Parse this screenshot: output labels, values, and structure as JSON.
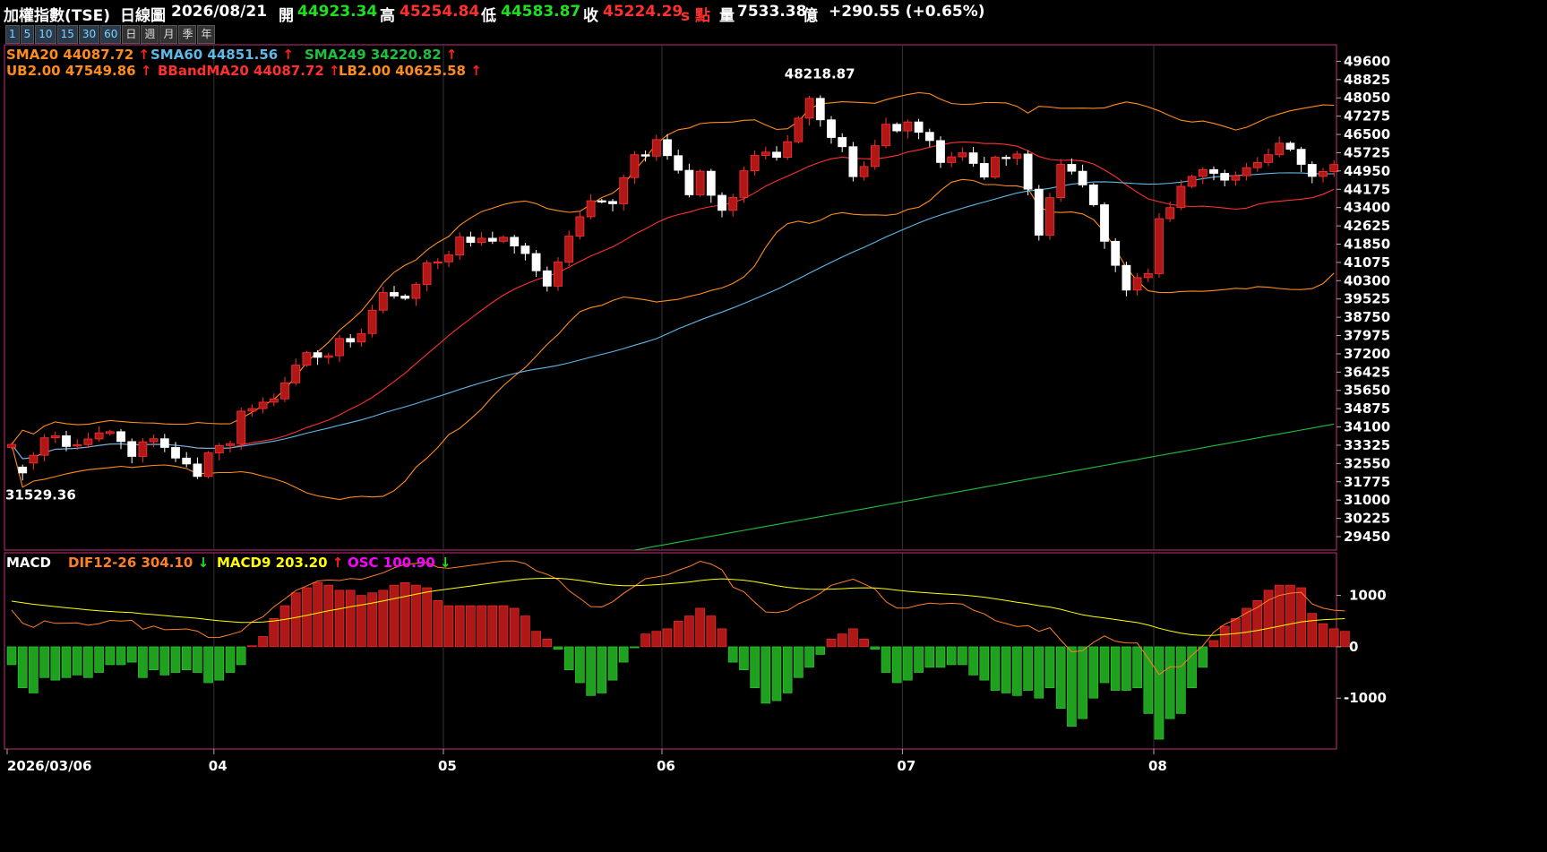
{
  "header": {
    "title": "加權指數(TSE)",
    "interval": "日線圖",
    "date": "2026/08/21",
    "open_label": "開",
    "open": "44923.34",
    "high_label": "高",
    "high": "45254.84",
    "low_label": "低",
    "low": "44583.87",
    "close_label": "收",
    "close": "45224.29",
    "unit_label": "s 點",
    "volume_label": "量",
    "volume": "7533.38",
    "volume_unit": "億",
    "change": "+290.55 (+0.65%)"
  },
  "periods": [
    "1",
    "5",
    "10",
    "15",
    "30",
    "60",
    "日",
    "週",
    "月",
    "季",
    "年"
  ],
  "legend_main": [
    {
      "text": "SMA20 44087.72",
      "color": "#ff8c1a"
    },
    {
      "text": "SMA60 44851.56",
      "color": "#5fb8e8"
    },
    {
      "text": "SMA249 34220.82",
      "color": "#1fbf3f"
    },
    {
      "text": "UB2.00 47549.86",
      "color": "#ff8c1a"
    },
    {
      "text": "BBandMA20 44087.72",
      "color": "#ff3030"
    },
    {
      "text": "LB2.00 40625.58",
      "color": "#ff8c1a"
    }
  ],
  "legend_macd": [
    {
      "text": "MACD",
      "color": "#ffffff",
      "arrow": ""
    },
    {
      "text": "DIF12-26 304.10",
      "color": "#ff7f27",
      "arrow": "down"
    },
    {
      "text": "MACD9 203.20",
      "color": "#ffff00",
      "arrow": "up"
    },
    {
      "text": "OSC 100.90",
      "color": "#ff00ff",
      "arrow": "down"
    }
  ],
  "colors": {
    "up": "#b01818",
    "down": "#ffffff",
    "osc_up": "#b01818",
    "osc_down": "#1fa01f",
    "bband": "#ff8c1a",
    "mid": "#ff3030",
    "sma60": "#5fb8e8",
    "sma249": "#1fbf3f",
    "dif": "#ff7f27",
    "macd": "#ffff00"
  },
  "chart_data": [
    {
      "type": "candlestick",
      "x_labels": [
        "2026/03/06",
        "04",
        "05",
        "06",
        "07",
        "08"
      ],
      "y_ticks": [
        49600,
        48825,
        48050,
        47275,
        46500,
        45725,
        44950,
        44175,
        43400,
        42625,
        41850,
        41075,
        40300,
        39525,
        38750,
        37975,
        37200,
        36425,
        35650,
        34875,
        34100,
        33325,
        32550,
        31775,
        31000,
        30225,
        29450
      ],
      "ylim": [
        28880,
        50300
      ],
      "annotations": [
        {
          "text": "48218.87",
          "index": 74
        },
        {
          "text": "31529.36",
          "index": 1
        }
      ],
      "series_close": [
        33360,
        32150,
        32900,
        33640,
        33730,
        33270,
        33350,
        33590,
        33850,
        33900,
        33480,
        32850,
        33470,
        33600,
        33230,
        32780,
        32530,
        32000,
        33000,
        33310,
        33390,
        34770,
        34880,
        35150,
        35290,
        35970,
        36720,
        37250,
        37050,
        37120,
        37850,
        37700,
        38060,
        39050,
        39800,
        39650,
        39550,
        40140,
        41050,
        41100,
        41390,
        42150,
        41920,
        42100,
        41970,
        42140,
        41770,
        41450,
        40720,
        40070,
        41090,
        42190,
        43010,
        43690,
        43660,
        43560,
        44670,
        45640,
        45580,
        46280,
        45600,
        44980,
        43940,
        44940,
        43920,
        43280,
        43830,
        44960,
        45610,
        45750,
        45530,
        46190,
        47190,
        48030,
        47120,
        46370,
        45980,
        44710,
        45140,
        46020,
        46930,
        46650,
        47030,
        46590,
        46240,
        45310,
        45550,
        45720,
        45270,
        44690,
        45530,
        45490,
        45670,
        44180,
        42230,
        43820,
        45230,
        44940,
        44360,
        43520,
        41970,
        40950,
        39900,
        40430,
        40600,
        42930,
        43400,
        44300,
        44720,
        45010,
        44850,
        44560,
        44750,
        45090,
        45310,
        45640,
        46130,
        45870,
        45230,
        44720,
        44930,
        45224.29
      ],
      "series_open": [
        33230,
        32400,
        32570,
        32900,
        33640,
        33730,
        33300,
        33350,
        33590,
        33820,
        33900,
        33480,
        32850,
        33470,
        33600,
        33230,
        32780,
        32530,
        32000,
        33000,
        33310,
        33390,
        34770,
        34880,
        35150,
        35290,
        35970,
        36720,
        37250,
        37050,
        37120,
        37850,
        37700,
        38060,
        39050,
        39800,
        39650,
        39550,
        40140,
        41050,
        41100,
        41390,
        42150,
        41920,
        42100,
        41970,
        42140,
        41770,
        41450,
        40720,
        40070,
        41090,
        42190,
        43010,
        43690,
        43660,
        43560,
        44670,
        45640,
        45580,
        46280,
        45600,
        44980,
        43940,
        44940,
        43920,
        43280,
        43830,
        44960,
        45610,
        45750,
        45530,
        46190,
        47190,
        48030,
        47120,
        46370,
        45980,
        44710,
        45140,
        46020,
        46930,
        46650,
        47030,
        46590,
        46240,
        45310,
        45550,
        45720,
        45270,
        44690,
        45530,
        45490,
        45670,
        44180,
        42230,
        43820,
        45230,
        44940,
        44360,
        43520,
        41970,
        40950,
        39900,
        40430,
        40600,
        42930,
        43400,
        44300,
        44720,
        45010,
        44850,
        44560,
        44750,
        45090,
        45310,
        45640,
        46130,
        45870,
        45230,
        44720,
        44923.34
      ]
    },
    {
      "type": "bar",
      "title": "MACD",
      "y_ticks": [
        1000,
        0,
        -1000
      ],
      "ylim": [
        -1990,
        1830
      ],
      "osc": [
        -350,
        -800,
        -900,
        -600,
        -650,
        -600,
        -550,
        -600,
        -500,
        -350,
        -350,
        -300,
        -600,
        -450,
        -550,
        -500,
        -450,
        -500,
        -700,
        -650,
        -500,
        -350,
        20,
        200,
        550,
        800,
        1050,
        1150,
        1250,
        1200,
        1100,
        1100,
        1000,
        1050,
        1100,
        1200,
        1250,
        1200,
        1150,
        900,
        800,
        800,
        800,
        800,
        800,
        800,
        750,
        600,
        300,
        150,
        -50,
        -450,
        -700,
        -950,
        -900,
        -650,
        -300,
        -20,
        250,
        300,
        350,
        500,
        600,
        750,
        600,
        350,
        -300,
        -450,
        -800,
        -1100,
        -1050,
        -900,
        -600,
        -400,
        -150,
        150,
        250,
        350,
        150,
        -50,
        -500,
        -700,
        -650,
        -500,
        -400,
        -400,
        -350,
        -350,
        -550,
        -650,
        -850,
        -900,
        -950,
        -850,
        -1000,
        -800,
        -1200,
        -1550,
        -1400,
        -1000,
        -700,
        -850,
        -850,
        -800,
        -1300,
        -1800,
        -1400,
        -1300,
        -800,
        -400,
        120,
        400,
        550,
        750,
        900,
        1100,
        1200,
        1200,
        1150,
        650,
        450,
        350,
        300
      ]
    }
  ]
}
